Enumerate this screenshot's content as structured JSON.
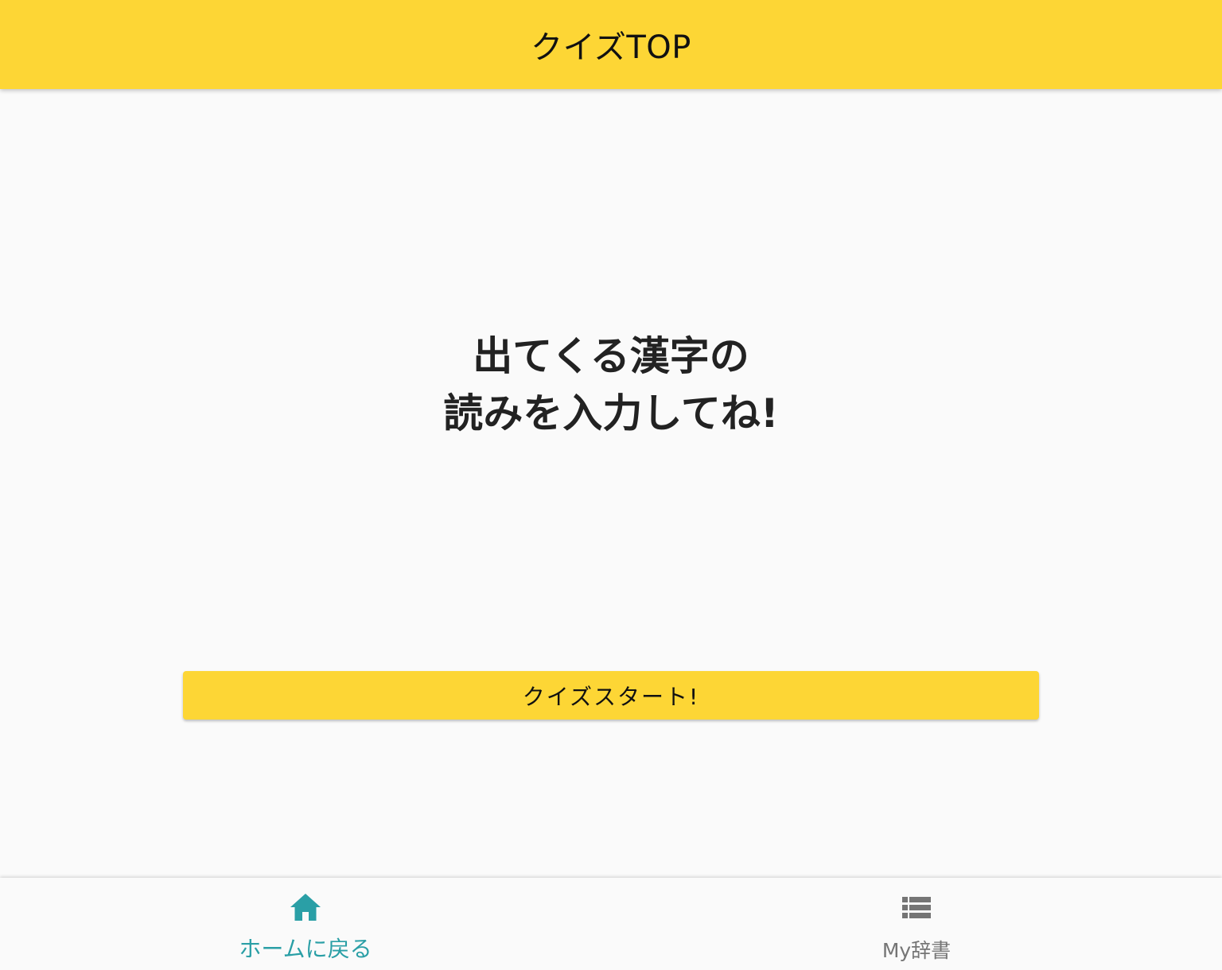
{
  "app_bar": {
    "title": "クイズTOP"
  },
  "main": {
    "instruction_line1": "出てくる漢字の",
    "instruction_line2": "読みを入力してね!",
    "start_button_label": "クイズスタート!"
  },
  "bottom_nav": {
    "items": [
      {
        "label": "ホームに戻る",
        "icon": "home-icon",
        "active": true
      },
      {
        "label": "My辞書",
        "icon": "list-icon",
        "active": false
      }
    ]
  },
  "colors": {
    "accent_yellow": "#fdd635",
    "active_teal": "#2a9fa6",
    "inactive_gray": "#757575",
    "background": "#fafafa",
    "text_dark": "#222222"
  }
}
